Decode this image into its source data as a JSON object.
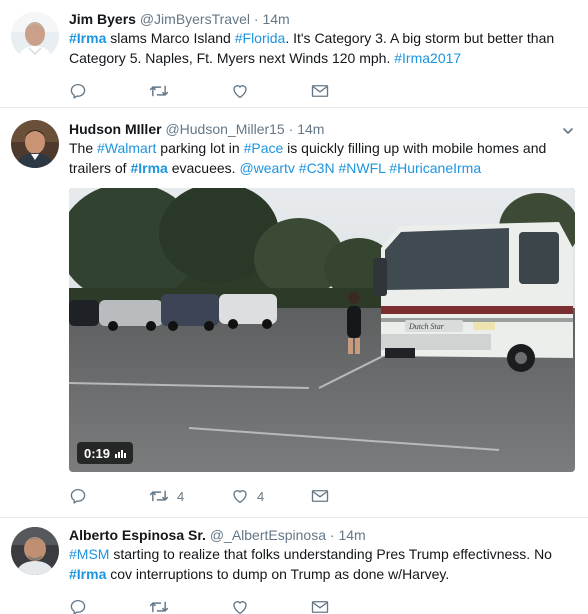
{
  "tweets": [
    {
      "name": "Jim Byers",
      "handle": "@JimByersTravel",
      "separator": "·",
      "time": "14m",
      "text": [
        {
          "t": "#Irma",
          "style": "hashtag-bold"
        },
        {
          "t": " slams Marco Island ",
          "style": "plain"
        },
        {
          "t": "#Florida",
          "style": "hashtag"
        },
        {
          "t": ". It's Category 3. A big storm but better than Category 5. Naples, Ft. Myers next Winds 120 mph. ",
          "style": "plain"
        },
        {
          "t": "#Irma2017",
          "style": "hashtag"
        }
      ],
      "actions": {
        "replies": "",
        "retweets": "",
        "likes": ""
      }
    },
    {
      "name": "Hudson MIller",
      "handle": "@Hudson_Miller15",
      "separator": "·",
      "time": "14m",
      "text": [
        {
          "t": "The ",
          "style": "plain"
        },
        {
          "t": "#Walmart",
          "style": "hashtag"
        },
        {
          "t": " parking lot in ",
          "style": "plain"
        },
        {
          "t": "#Pace",
          "style": "hashtag"
        },
        {
          "t": " is quickly filling up with mobile homes and trailers of ",
          "style": "plain"
        },
        {
          "t": "#Irma",
          "style": "hashtag-bold"
        },
        {
          "t": " evacuees. ",
          "style": "plain"
        },
        {
          "t": "@weartv",
          "style": "hashtag"
        },
        {
          "t": " ",
          "style": "plain"
        },
        {
          "t": "#C3N",
          "style": "hashtag"
        },
        {
          "t": " ",
          "style": "plain"
        },
        {
          "t": "#NWFL",
          "style": "hashtag"
        },
        {
          "t": " ",
          "style": "plain"
        },
        {
          "t": "#HuricaneIrma",
          "style": "hashtag"
        }
      ],
      "video": {
        "duration": "0:19",
        "rv_label": "Dutch Star"
      },
      "actions": {
        "replies": "",
        "retweets": "4",
        "likes": "4"
      }
    },
    {
      "name": "Alberto Espinosa Sr.",
      "handle": "@_AlbertEspinosa",
      "separator": "·",
      "time": "14m",
      "text": [
        {
          "t": "#MSM",
          "style": "hashtag"
        },
        {
          "t": " starting to realize that folks understanding Pres Trump effectivness.  No ",
          "style": "plain"
        },
        {
          "t": "#Irma",
          "style": "hashtag-bold"
        },
        {
          "t": " cov interruptions to dump on Trump as done w/Harvey.",
          "style": "plain"
        }
      ],
      "actions": {
        "replies": "",
        "retweets": "",
        "likes": ""
      }
    }
  ],
  "icons": {
    "reply": "reply-icon",
    "retweet": "retweet-icon",
    "like": "heart-icon",
    "dm": "envelope-icon",
    "caret": "chevron-down-icon",
    "volume": "sound-bars-icon"
  },
  "colors": {
    "link": "#1c94e0",
    "muted": "#657786",
    "text": "#14171a",
    "divider": "#e6ecf0"
  }
}
